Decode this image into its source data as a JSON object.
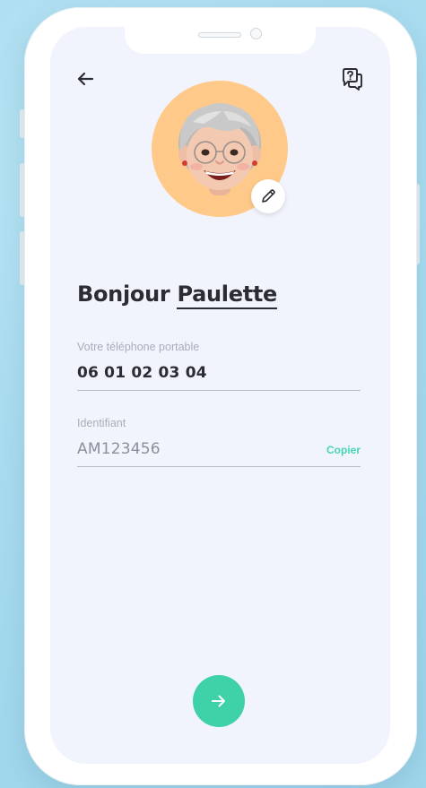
{
  "header": {
    "back_icon": "arrow-left-icon",
    "help_icon": "question-chat-icon"
  },
  "avatar": {
    "background_color": "#ffc98a",
    "edit_icon": "pencil-icon"
  },
  "greeting": {
    "prefix": "Bonjour",
    "name": "Paulette"
  },
  "phone_field": {
    "label": "Votre téléphone portable",
    "value": "06 01 02 03 04"
  },
  "id_field": {
    "label": "Identifiant",
    "value": "AM123456",
    "copy_label": "Copier"
  },
  "next_button": {
    "icon": "arrow-right-icon",
    "color": "#3fd1a8"
  },
  "colors": {
    "accent": "#3fd1a8",
    "copy_link": "#44d6b4",
    "screen_background": "#f2f4fd",
    "text_primary": "#2b2d33"
  }
}
